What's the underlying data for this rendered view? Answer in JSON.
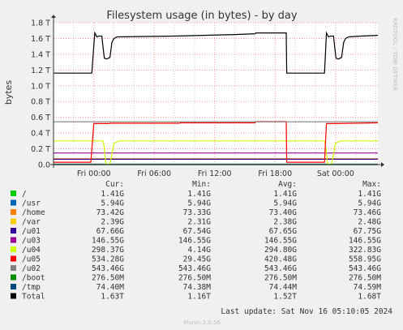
{
  "title": "Filesystem usage (in bytes) - by day",
  "side_label": "RRDTOOL / TOBI OETIKER",
  "footer": "Munin 2.0.56",
  "last_update": "Last update: Sat Nov 16 05:10:05 2024",
  "columns": {
    "cur": "Cur:",
    "min": "Min:",
    "avg": "Avg:",
    "max": "Max:"
  },
  "colors": {
    "background": "#f0f0f0",
    "plot_background": "#ffffff",
    "grid_major": "#ff9b9b",
    "grid_minor": "#e8c8c8"
  },
  "chart_data": {
    "type": "line",
    "ylabel": "bytes",
    "ylim": [
      0,
      1.8
    ],
    "y_ticks": [
      {
        "value": 0,
        "label": "0.0"
      },
      {
        "value": 0.2,
        "label": "0.2 T"
      },
      {
        "value": 0.4,
        "label": "0.4 T"
      },
      {
        "value": 0.6,
        "label": "0.6 T"
      },
      {
        "value": 0.8,
        "label": "0.8 T"
      },
      {
        "value": 1.0,
        "label": "1.0 T"
      },
      {
        "value": 1.2,
        "label": "1.2 T"
      },
      {
        "value": 1.4,
        "label": "1.4 T"
      },
      {
        "value": 1.6,
        "label": "1.6 T"
      },
      {
        "value": 1.8,
        "label": "1.8 T"
      }
    ],
    "x_range": [
      -2,
      30.2
    ],
    "x_ticks": [
      {
        "value": 2,
        "label": "Fri 00:00"
      },
      {
        "value": 8,
        "label": "Fri 06:00"
      },
      {
        "value": 14,
        "label": "Fri 12:00"
      },
      {
        "value": 20,
        "label": "Fri 18:00"
      },
      {
        "value": 26,
        "label": "Sat 00:00"
      }
    ],
    "series": [
      {
        "name": "/",
        "color": "#00cc00",
        "cur": "1.41G",
        "min": "1.41G",
        "avg": "1.41G",
        "max": "1.41G",
        "points": [
          [
            -2,
            0.0014
          ],
          [
            30.2,
            0.0014
          ]
        ]
      },
      {
        "name": "/usr",
        "color": "#0066b3",
        "cur": "5.94G",
        "min": "5.94G",
        "avg": "5.94G",
        "max": "5.94G",
        "points": [
          [
            -2,
            0.006
          ],
          [
            30.2,
            0.006
          ]
        ]
      },
      {
        "name": "/home",
        "color": "#ff8000",
        "cur": "73.42G",
        "min": "73.33G",
        "avg": "73.40G",
        "max": "73.46G",
        "points": [
          [
            -2,
            0.073
          ],
          [
            30.2,
            0.073
          ]
        ]
      },
      {
        "name": "/var",
        "color": "#ffcc00",
        "cur": "2.39G",
        "min": "2.31G",
        "avg": "2.38G",
        "max": "2.48G",
        "points": [
          [
            -2,
            0.0024
          ],
          [
            30.2,
            0.0024
          ]
        ]
      },
      {
        "name": "/u01",
        "color": "#330099",
        "cur": "67.66G",
        "min": "67.54G",
        "avg": "67.65G",
        "max": "67.75G",
        "points": [
          [
            -2,
            0.068
          ],
          [
            30.2,
            0.068
          ]
        ]
      },
      {
        "name": "/u03",
        "color": "#990099",
        "cur": "146.55G",
        "min": "146.55G",
        "avg": "146.55G",
        "max": "146.55G",
        "points": [
          [
            -2,
            0.147
          ],
          [
            30.2,
            0.147
          ]
        ]
      },
      {
        "name": "/u04",
        "color": "#ccff00",
        "cur": "298.37G",
        "min": "4.14G",
        "avg": "294.80G",
        "max": "322.83G",
        "points": [
          [
            -2,
            0.3
          ],
          [
            2.9,
            0.3
          ],
          [
            3.0,
            0.25
          ],
          [
            3.2,
            0.01
          ],
          [
            3.6,
            0.005
          ],
          [
            4.0,
            0.27
          ],
          [
            4.5,
            0.3
          ],
          [
            21.1,
            0.3
          ],
          [
            21.15,
            0.3
          ],
          [
            24.9,
            0.3
          ],
          [
            25.0,
            0.25
          ],
          [
            25.2,
            0.01
          ],
          [
            25.6,
            0.005
          ],
          [
            26.0,
            0.27
          ],
          [
            26.5,
            0.3
          ],
          [
            30.2,
            0.3
          ]
        ]
      },
      {
        "name": "/u05",
        "color": "#ff0000",
        "cur": "534.28G",
        "min": "29.45G",
        "avg": "420.48G",
        "max": "558.95G",
        "points": [
          [
            -2,
            0.03
          ],
          [
            1.7,
            0.03
          ],
          [
            2.0,
            0.52
          ],
          [
            3.5,
            0.52
          ],
          [
            3.6,
            0.525
          ],
          [
            10.5,
            0.525
          ],
          [
            10.6,
            0.53
          ],
          [
            18.0,
            0.53
          ],
          [
            18.1,
            0.545
          ],
          [
            21.1,
            0.545
          ],
          [
            21.15,
            0.03
          ],
          [
            24.9,
            0.03
          ],
          [
            25.1,
            0.52
          ],
          [
            26.0,
            0.52
          ],
          [
            30.2,
            0.53
          ]
        ]
      },
      {
        "name": "/u02",
        "color": "#808080",
        "cur": "543.46G",
        "min": "543.46G",
        "avg": "543.46G",
        "max": "543.46G",
        "points": [
          [
            -2,
            0.543
          ],
          [
            30.2,
            0.543
          ]
        ]
      },
      {
        "name": "/boot",
        "color": "#008f00",
        "cur": "276.50M",
        "min": "276.50M",
        "avg": "276.50M",
        "max": "276.50M",
        "points": [
          [
            -2,
            0.0003
          ],
          [
            30.2,
            0.0003
          ]
        ]
      },
      {
        "name": "/tmp",
        "color": "#00487d",
        "cur": "74.40M",
        "min": "74.38M",
        "avg": "74.44M",
        "max": "74.59M",
        "points": [
          [
            -2,
            0.0001
          ],
          [
            30.2,
            0.0001
          ]
        ]
      },
      {
        "name": "Total",
        "color": "#000000",
        "cur": "1.63T",
        "min": "1.16T",
        "avg": "1.52T",
        "max": "1.68T",
        "points": [
          [
            -2,
            1.16
          ],
          [
            1.8,
            1.16
          ],
          [
            2.1,
            1.67
          ],
          [
            2.3,
            1.62
          ],
          [
            2.5,
            1.63
          ],
          [
            2.8,
            1.63
          ],
          [
            2.95,
            1.45
          ],
          [
            3.05,
            1.35
          ],
          [
            3.3,
            1.34
          ],
          [
            3.6,
            1.36
          ],
          [
            3.8,
            1.55
          ],
          [
            4.0,
            1.6
          ],
          [
            4.3,
            1.62
          ],
          [
            10.0,
            1.63
          ],
          [
            16.0,
            1.65
          ],
          [
            18.0,
            1.66
          ],
          [
            18.1,
            1.67
          ],
          [
            21.1,
            1.67
          ],
          [
            21.15,
            1.16
          ],
          [
            24.9,
            1.16
          ],
          [
            25.1,
            1.67
          ],
          [
            25.3,
            1.62
          ],
          [
            25.5,
            1.63
          ],
          [
            25.8,
            1.63
          ],
          [
            25.95,
            1.45
          ],
          [
            26.05,
            1.35
          ],
          [
            26.3,
            1.34
          ],
          [
            26.6,
            1.36
          ],
          [
            26.8,
            1.55
          ],
          [
            27.0,
            1.6
          ],
          [
            27.3,
            1.62
          ],
          [
            28.5,
            1.63
          ],
          [
            30.2,
            1.64
          ]
        ]
      }
    ]
  }
}
